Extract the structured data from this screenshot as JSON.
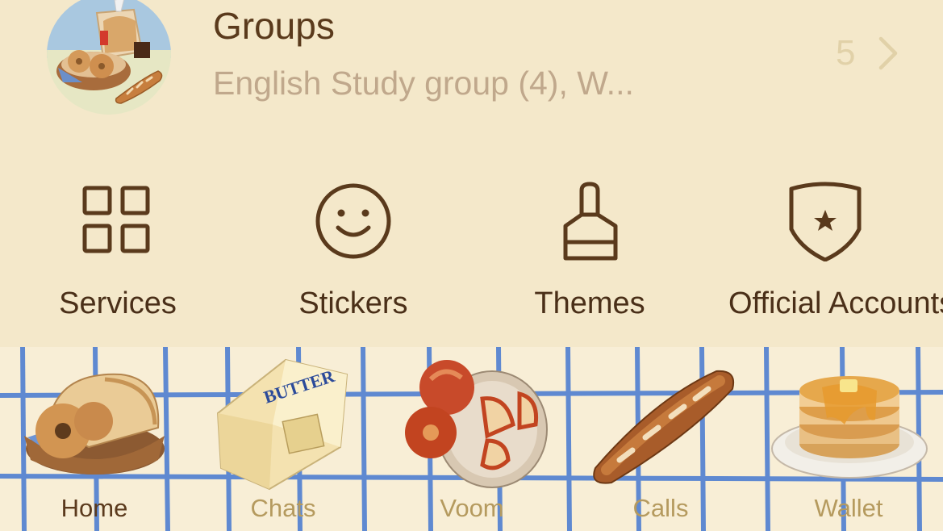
{
  "groups": {
    "title": "Groups",
    "subtitle": "English Study group (4), W...",
    "count": "5",
    "avatar_icon": "bread-bakery-avatar",
    "chevron_icon": "chevron-right-icon"
  },
  "quick_menu": [
    {
      "label": "Services",
      "icon": "grid-icon"
    },
    {
      "label": "Stickers",
      "icon": "smiley-icon"
    },
    {
      "label": "Themes",
      "icon": "brush-icon"
    },
    {
      "label": "Official Accounts",
      "icon": "shield-star-icon"
    }
  ],
  "tabs": [
    {
      "label": "Home",
      "icon": "bread-basket-icon",
      "active": true
    },
    {
      "label": "Chats",
      "icon": "butter-icon",
      "active": false
    },
    {
      "label": "Voom",
      "icon": "apples-plate-icon",
      "active": false
    },
    {
      "label": "Calls",
      "icon": "baguette-icon",
      "active": false
    },
    {
      "label": "Wallet",
      "icon": "pancakes-icon",
      "active": false
    }
  ],
  "colors": {
    "background": "#f4e8ca",
    "text_primary": "#5a3a1c",
    "text_secondary": "#c0a88c",
    "tab_active": "#5b3a1d",
    "tab_inactive": "#b59a5e",
    "grid_blue": "#4f7fd1"
  }
}
